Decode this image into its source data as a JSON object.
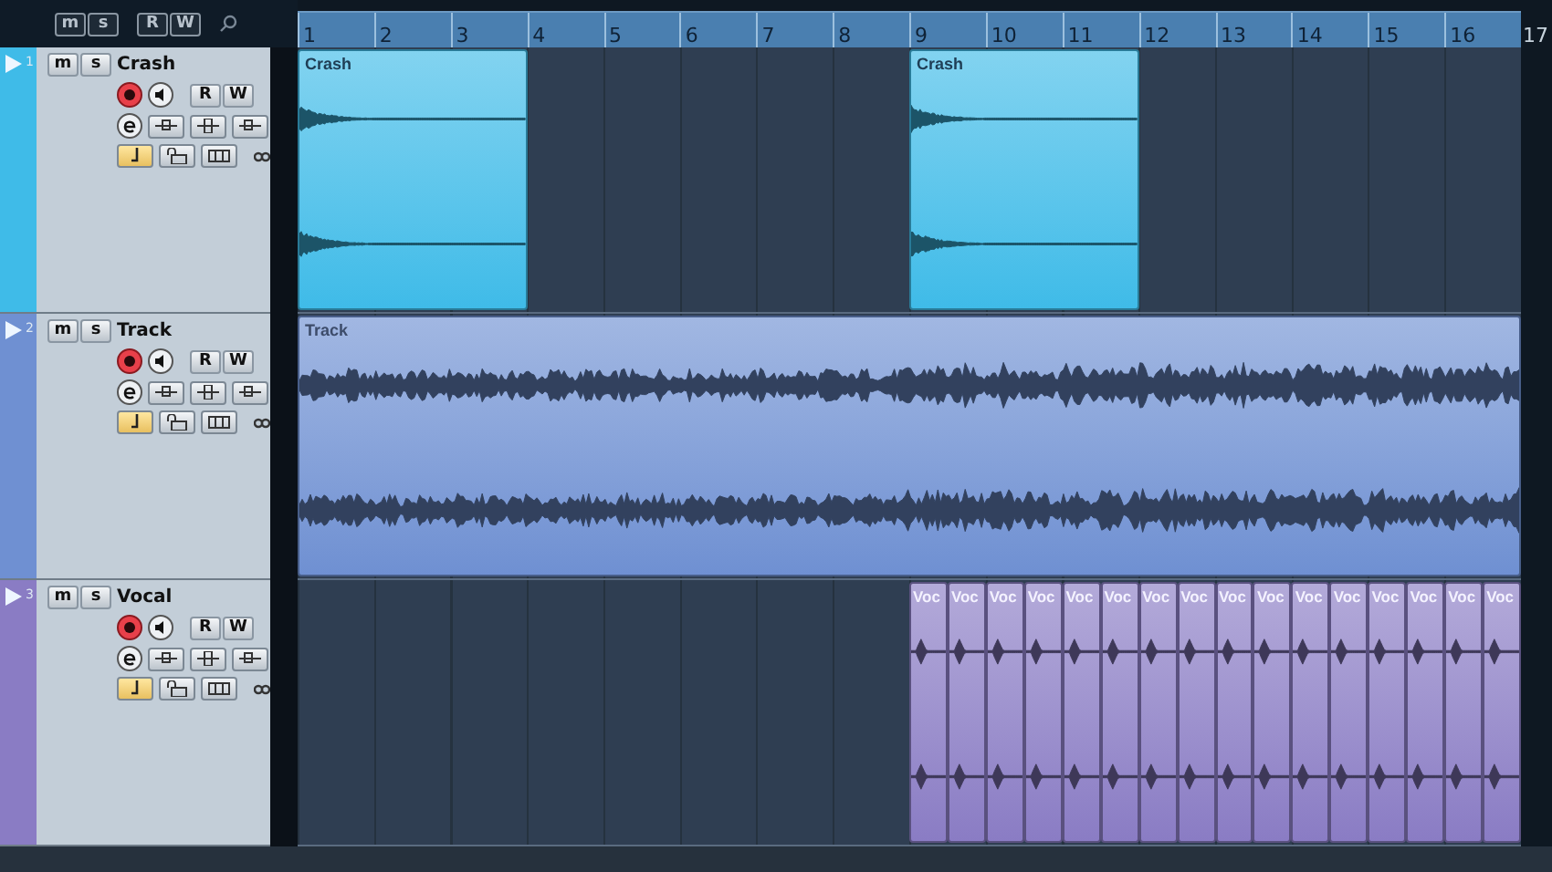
{
  "toolbar": {
    "buttons": [
      "m",
      "s",
      "R",
      "W"
    ]
  },
  "ruler": {
    "bars": [
      "1",
      "2",
      "3",
      "4",
      "5",
      "6",
      "7",
      "8",
      "9",
      "10",
      "11",
      "12",
      "13",
      "14",
      "15",
      "16"
    ],
    "end": "17"
  },
  "tracks": [
    {
      "number": "1",
      "name": "Crash",
      "color": "#3fbbe8",
      "kind": "burst",
      "buttons": [
        "m",
        "s",
        "R",
        "W"
      ],
      "clips": [
        {
          "label": "Crash"
        },
        {
          "label": "Crash"
        }
      ]
    },
    {
      "number": "2",
      "name": "Track",
      "color": "#6f90d2",
      "kind": "dense",
      "buttons": [
        "m",
        "s",
        "R",
        "W"
      ],
      "clips": [
        {
          "label": "Track"
        }
      ]
    },
    {
      "number": "3",
      "name": "Vocal",
      "color": "#8a7cc4",
      "kind": "blip",
      "buttons": [
        "m",
        "s",
        "R",
        "W"
      ],
      "clips": [
        {
          "label": "Voc"
        },
        {
          "label": "Voc"
        },
        {
          "label": "Voc"
        },
        {
          "label": "Voc"
        },
        {
          "label": "Voc"
        },
        {
          "label": "Voc"
        },
        {
          "label": "Voc"
        },
        {
          "label": "Voc"
        },
        {
          "label": "Voc"
        },
        {
          "label": "Voc"
        },
        {
          "label": "Voc"
        },
        {
          "label": "Voc"
        },
        {
          "label": "Voc"
        },
        {
          "label": "Voc"
        },
        {
          "label": "Voc"
        },
        {
          "label": "Voc"
        }
      ]
    }
  ]
}
